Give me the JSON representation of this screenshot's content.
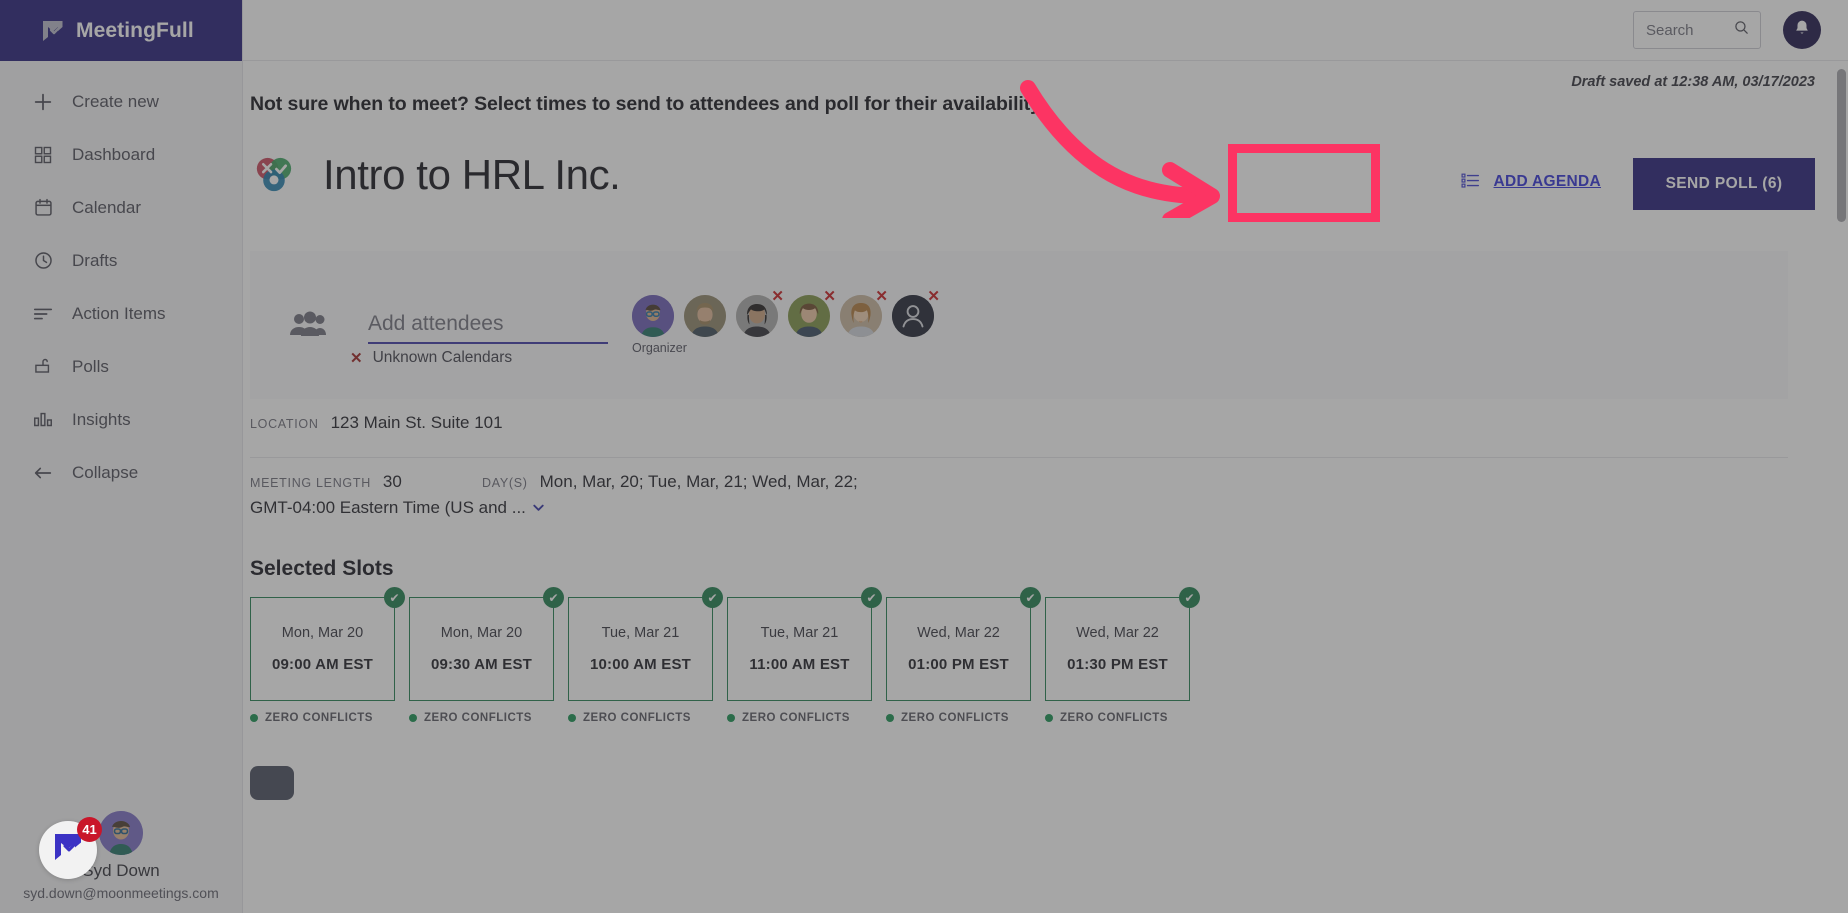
{
  "brand": {
    "name": "MeetingFull",
    "logo_icon": "meetingfull-logo-icon",
    "color": "#211a77"
  },
  "sidebar": {
    "items": [
      {
        "label": "Create new",
        "icon": "plus-icon"
      },
      {
        "label": "Dashboard",
        "icon": "grid-icon"
      },
      {
        "label": "Calendar",
        "icon": "calendar-icon"
      },
      {
        "label": "Drafts",
        "icon": "clock-icon"
      },
      {
        "label": "Action Items",
        "icon": "list-lines-icon"
      },
      {
        "label": "Polls",
        "icon": "poll-box-icon"
      },
      {
        "label": "Insights",
        "icon": "bar-chart-icon"
      },
      {
        "label": "Collapse",
        "icon": "arrow-left-icon"
      }
    ],
    "user": {
      "name": "Syd Down",
      "email": "syd.down@moonmeetings.com",
      "avatar_icon": "user-avatar"
    }
  },
  "topbar": {
    "search": {
      "placeholder": "Search",
      "value": "",
      "icon": "search-icon"
    },
    "notifications_icon": "bell-icon"
  },
  "main": {
    "draft_saved": "Draft saved at 12:38 AM, 03/17/2023",
    "lede": "Not sure when to meet? Select times to send to attendees and poll for their availability.",
    "title": "Intro to HRL Inc.",
    "title_icon": "poll-venn-icon",
    "actions": {
      "add_agenda_label": "ADD AGENDA",
      "add_agenda_icon": "agenda-list-icon",
      "send_poll_label": "SEND POLL (6)"
    },
    "attendees": {
      "icon": "people-icon",
      "input_placeholder": "Add attendees",
      "input_value": "",
      "organizer_caption": "Organizer",
      "list": [
        {
          "name": "organizer-avatar",
          "kind": "organizer",
          "removable": false
        },
        {
          "name": "attendee-avatar-2",
          "kind": "photo",
          "removable": false
        },
        {
          "name": "attendee-avatar-3",
          "kind": "photo",
          "removable": true
        },
        {
          "name": "attendee-avatar-4",
          "kind": "photo",
          "removable": true
        },
        {
          "name": "attendee-avatar-5",
          "kind": "photo",
          "removable": true
        },
        {
          "name": "attendee-avatar-6",
          "kind": "unknown",
          "removable": true
        }
      ],
      "unknown_calendars_label": "Unknown Calendars",
      "unknown_calendars_marker": "x"
    },
    "meta": {
      "location_label": "LOCATION",
      "location_value": "123 Main St. Suite 101",
      "meeting_length_label": "MEETING LENGTH",
      "meeting_length_value": "30",
      "days_label": "DAY(S)",
      "days_value": "Mon, Mar, 20; Tue, Mar, 21; Wed, Mar, 22;",
      "timezone_value": "GMT-04:00 Eastern Time (US and ...",
      "timezone_chevron": "chevron-down-icon"
    },
    "slots": {
      "heading": "Selected Slots",
      "conflict_label": "ZERO CONFLICTS",
      "check_icon": "check-circle-icon",
      "items": [
        {
          "date": "Mon, Mar 20",
          "time": "09:00 AM EST",
          "selected": true,
          "conflicts": "ZERO CONFLICTS"
        },
        {
          "date": "Mon, Mar 20",
          "time": "09:30 AM EST",
          "selected": true,
          "conflicts": "ZERO CONFLICTS"
        },
        {
          "date": "Tue, Mar 21",
          "time": "10:00 AM EST",
          "selected": true,
          "conflicts": "ZERO CONFLICTS"
        },
        {
          "date": "Tue, Mar 21",
          "time": "11:00 AM EST",
          "selected": true,
          "conflicts": "ZERO CONFLICTS"
        },
        {
          "date": "Wed, Mar 22",
          "time": "01:00 PM EST",
          "selected": true,
          "conflicts": "ZERO CONFLICTS"
        },
        {
          "date": "Wed, Mar 22",
          "time": "01:30 PM EST",
          "selected": true,
          "conflicts": "ZERO CONFLICTS"
        }
      ]
    }
  },
  "chat_widget": {
    "badge": "41",
    "icon": "meetingfull-chat-icon"
  },
  "annotation": {
    "highlight_color": "#fc3463",
    "arrow_icon": "curved-arrow-icon"
  }
}
